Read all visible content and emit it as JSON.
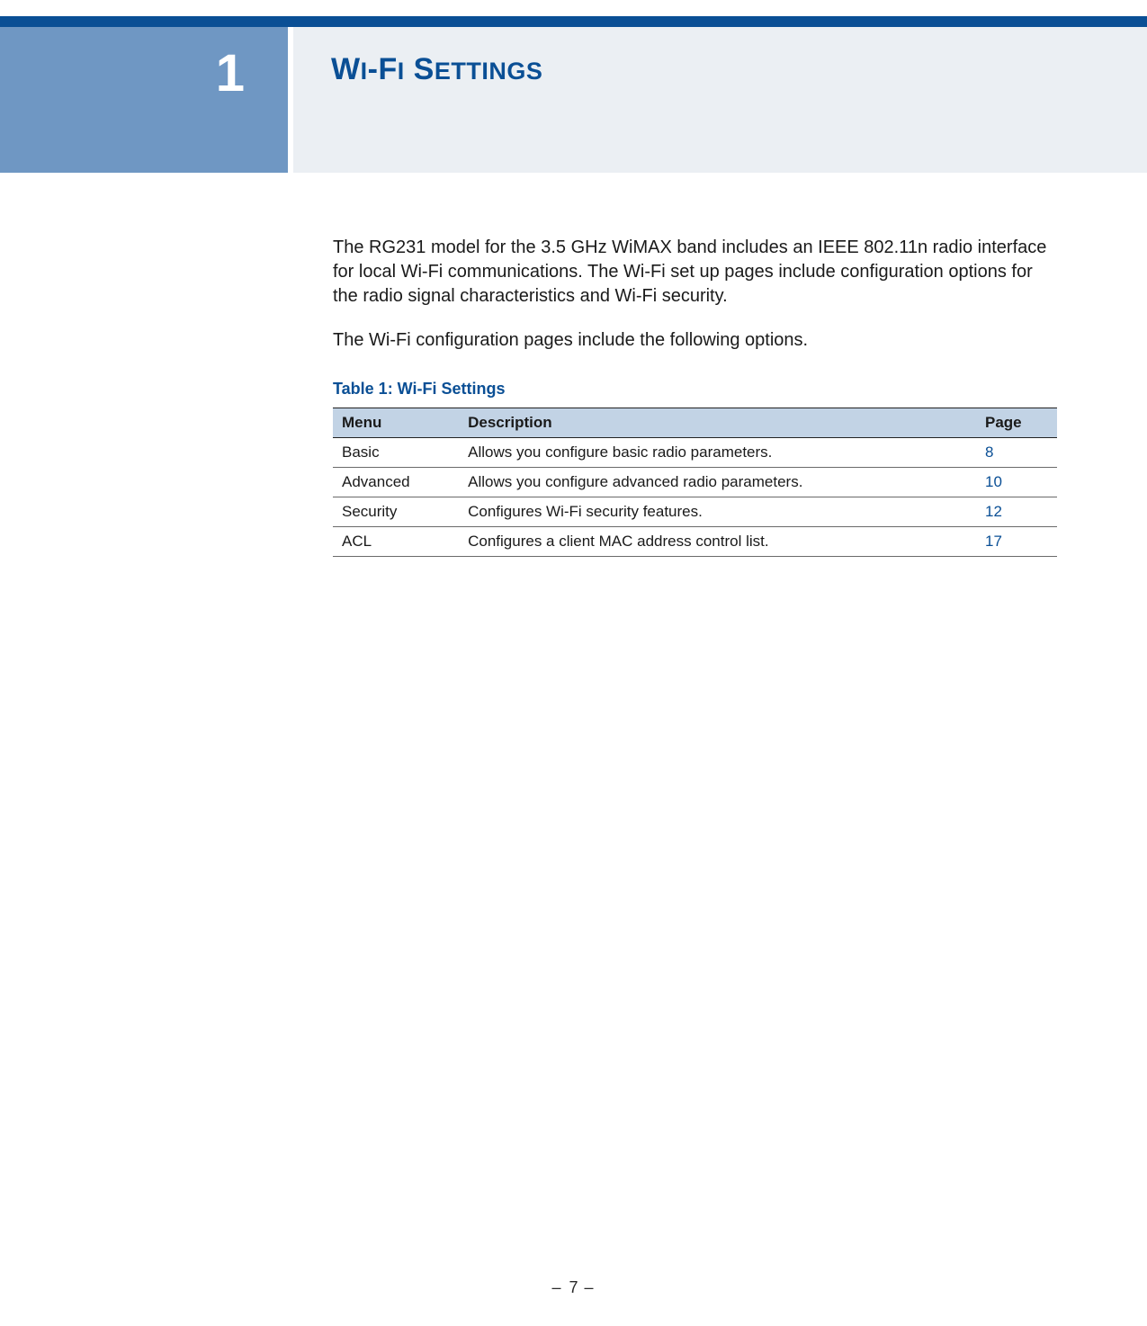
{
  "chapter": {
    "number": "1",
    "title_word1_big": "W",
    "title_word1_small": "I",
    "title_hyphen": "-",
    "title_word2_big": "F",
    "title_word2_small": "I",
    "title_word3_big": " S",
    "title_word3_small": "ETTINGS"
  },
  "paragraphs": {
    "p1": "The RG231 model for the 3.5 GHz WiMAX band includes an IEEE 802.11n radio interface for local Wi-Fi communications. The Wi-Fi set up pages include configuration options for the radio signal characteristics and Wi-Fi security.",
    "p2": "The Wi-Fi configuration pages include the following options."
  },
  "table": {
    "caption": "Table 1: Wi-Fi Settings",
    "headers": {
      "menu": "Menu",
      "description": "Description",
      "page": "Page"
    },
    "rows": [
      {
        "menu": "Basic",
        "description": "Allows you configure basic radio parameters.",
        "page": "8"
      },
      {
        "menu": "Advanced",
        "description": "Allows you configure advanced radio parameters.",
        "page": "10"
      },
      {
        "menu": "Security",
        "description": "Configures Wi-Fi security features.",
        "page": "12"
      },
      {
        "menu": "ACL",
        "description": "Configures a client MAC address control list.",
        "page": "17"
      }
    ]
  },
  "footer": {
    "page_number": "7"
  }
}
